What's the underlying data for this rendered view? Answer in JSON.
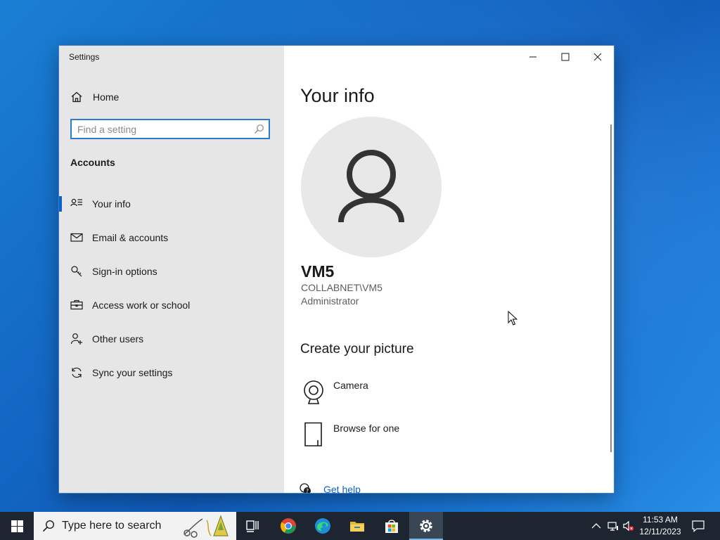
{
  "window": {
    "title": "Settings",
    "controls": [
      "minimize-icon",
      "maximize-icon",
      "close-icon"
    ]
  },
  "sidebar": {
    "home_label": "Home",
    "search_placeholder": "Find a setting",
    "section_title": "Accounts",
    "items": [
      {
        "label": "Your info",
        "icon": "your-info-icon",
        "selected": true
      },
      {
        "label": "Email & accounts",
        "icon": "mail-icon",
        "selected": false
      },
      {
        "label": "Sign-in options",
        "icon": "key-icon",
        "selected": false
      },
      {
        "label": "Access work or school",
        "icon": "briefcase-icon",
        "selected": false
      },
      {
        "label": "Other users",
        "icon": "person-add-icon",
        "selected": false
      },
      {
        "label": "Sync your settings",
        "icon": "sync-icon",
        "selected": false
      }
    ]
  },
  "content": {
    "title": "Your info",
    "user_name": "VM5",
    "user_domain": "COLLABNET\\VM5",
    "user_role": "Administrator",
    "create_picture_title": "Create your picture",
    "options": [
      {
        "label": "Camera",
        "icon": "camera-icon"
      },
      {
        "label": "Browse for one",
        "icon": "browse-file-icon"
      }
    ],
    "help_label": "Get help"
  },
  "taskbar": {
    "search_placeholder": "Type here to search",
    "apps": [
      "task-view-icon",
      "chrome-icon",
      "edge-icon",
      "file-explorer-icon",
      "store-icon",
      "settings-gear-icon"
    ],
    "active_app": "settings-gear-icon",
    "time": "11:53 AM",
    "date": "12/11/2023"
  },
  "colors": {
    "accent": "#0a63c9",
    "sidebar_bg": "#e6e6e6",
    "taskbar_bg": "#1c2530",
    "link": "#0a63c9"
  }
}
